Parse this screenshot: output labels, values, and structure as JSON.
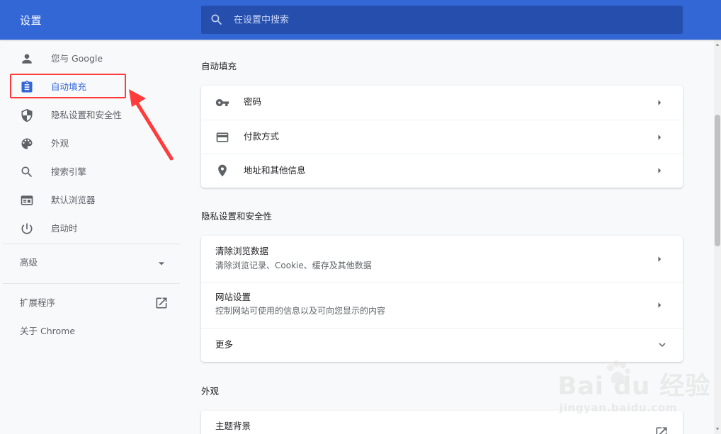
{
  "header": {
    "title": "设置",
    "search": {
      "placeholder": "在设置中搜索",
      "value": ""
    }
  },
  "sidebar": {
    "items": [
      {
        "label": "您与 Google",
        "icon": "person-icon"
      },
      {
        "label": "自动填充",
        "icon": "clipboard-icon",
        "active": true
      },
      {
        "label": "隐私设置和安全性",
        "icon": "shield-icon"
      },
      {
        "label": "外观",
        "icon": "palette-icon"
      },
      {
        "label": "搜索引擎",
        "icon": "search-icon"
      },
      {
        "label": "默认浏览器",
        "icon": "browser-window-icon"
      },
      {
        "label": "启动时",
        "icon": "power-icon"
      }
    ],
    "advanced_label": "高级",
    "extensions_label": "扩展程序",
    "about_label": "关于 Chrome"
  },
  "sections": {
    "autofill": {
      "title": "自动填充",
      "rows": [
        {
          "label": "密码",
          "icon": "key-icon"
        },
        {
          "label": "付款方式",
          "icon": "credit-card-icon"
        },
        {
          "label": "地址和其他信息",
          "icon": "location-pin-icon"
        }
      ]
    },
    "privacy": {
      "title": "隐私设置和安全性",
      "rows": [
        {
          "label": "清除浏览数据",
          "secondary": "清除浏览记录、Cookie、缓存及其他数据"
        },
        {
          "label": "网站设置",
          "secondary": "控制网站可使用的信息以及可向您显示的内容"
        },
        {
          "label": "更多"
        }
      ]
    },
    "appearance": {
      "title": "外观",
      "rows": [
        {
          "label": "主题背景"
        }
      ]
    }
  },
  "colors": {
    "header_blue": "#3367d6",
    "search_blue": "#264fad",
    "active_blue": "#3367d6",
    "annotation_red": "#ff3b3b"
  },
  "watermark": {
    "brand": "Bai du 经验",
    "url": "jingyan.baidu.com"
  }
}
